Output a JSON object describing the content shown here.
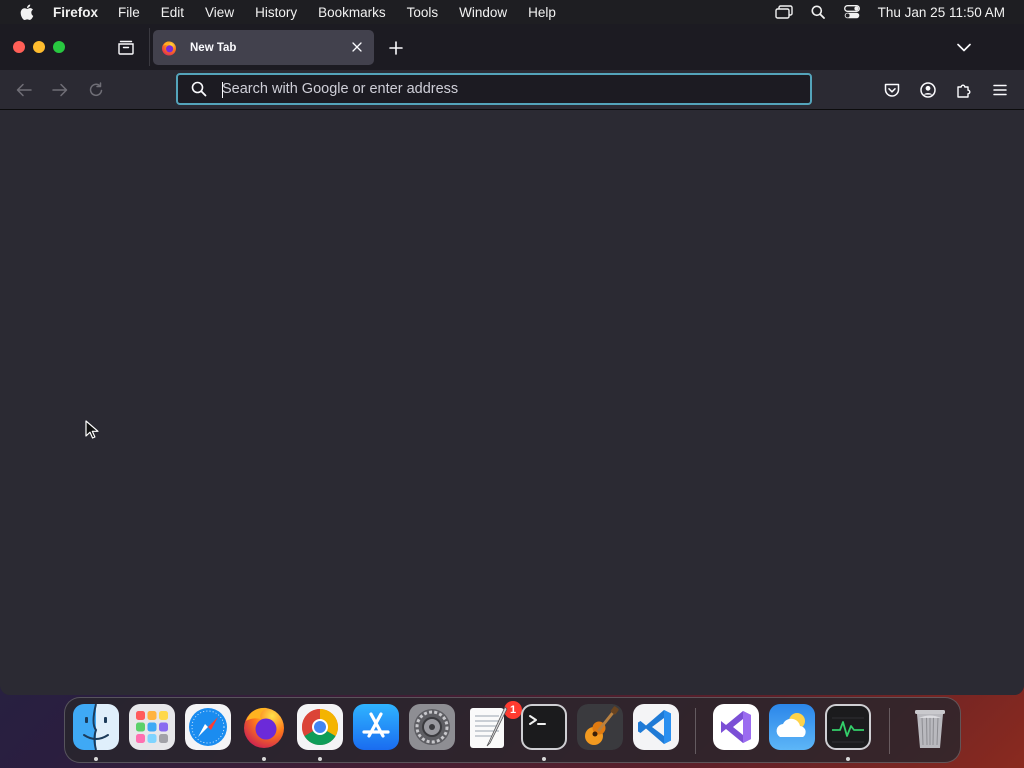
{
  "menubar": {
    "app_name": "Firefox",
    "items": [
      "File",
      "Edit",
      "View",
      "History",
      "Bookmarks",
      "Tools",
      "Window",
      "Help"
    ],
    "clock": "Thu Jan 25  11:50 AM"
  },
  "tab": {
    "title": "New Tab"
  },
  "urlbar": {
    "placeholder": "Search with Google or enter address",
    "value": ""
  },
  "dock": {
    "apps": [
      "Finder",
      "Launchpad",
      "Safari",
      "Firefox",
      "Google Chrome",
      "App Store",
      "System Settings",
      "TextEdit",
      "Terminal",
      "GarageBand",
      "Visual Studio Code",
      "Visual Studio",
      "Weather",
      "Activity Monitor",
      "Trash"
    ],
    "settings_badge": "1"
  },
  "colors": {
    "accent": "#54a4bb",
    "window_bg": "#2b2a33",
    "tabbar_bg": "#1c1b22",
    "tab_bg": "#42414d"
  }
}
